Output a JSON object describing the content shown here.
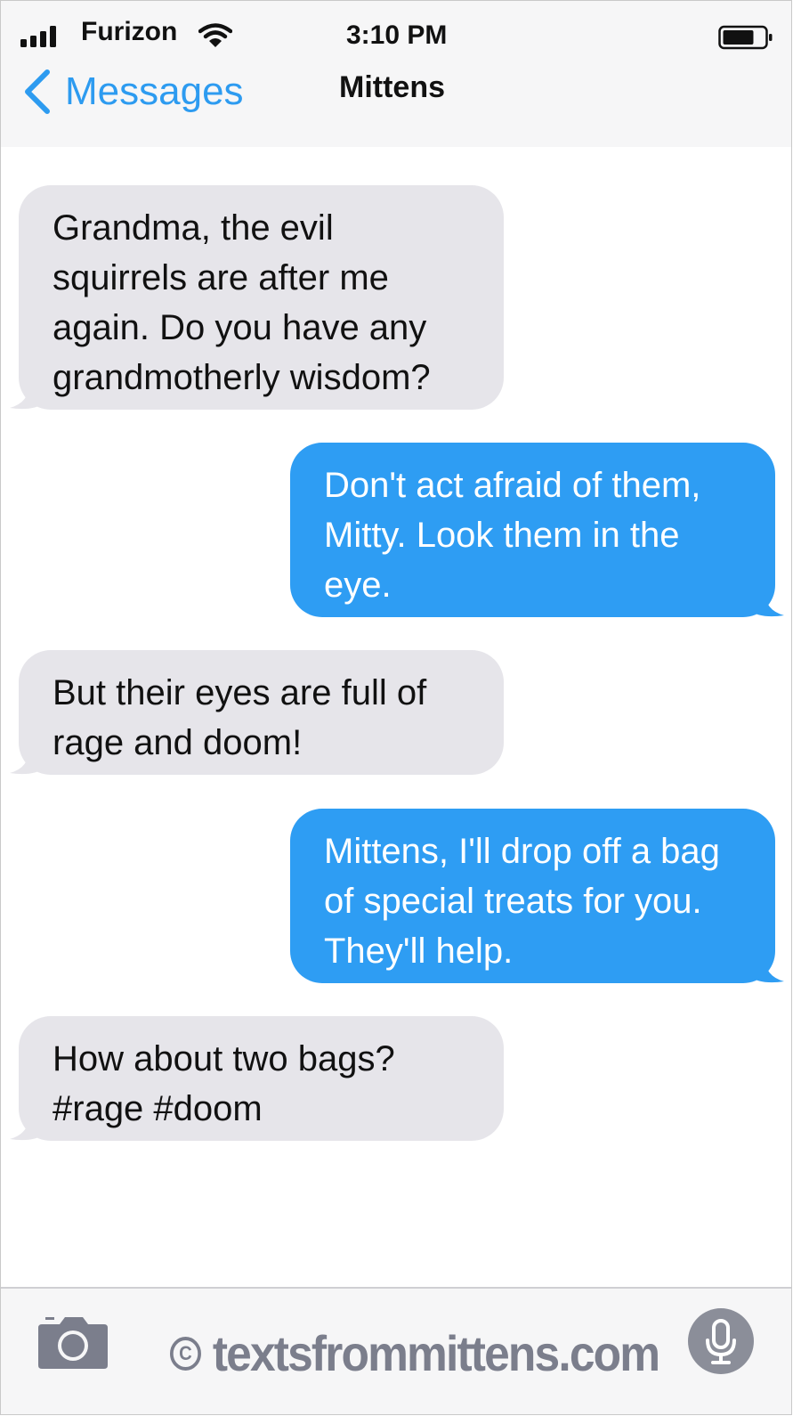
{
  "status_bar": {
    "carrier": "Furizon",
    "time": "3:10 PM",
    "signal_icon": "signal-bars-icon",
    "wifi_icon": "wifi-icon",
    "battery_icon": "battery-icon"
  },
  "nav": {
    "back_label": "Messages",
    "back_icon": "chevron-left-icon",
    "contact_name": "Mittens"
  },
  "messages": [
    {
      "direction": "received",
      "text": "Grandma, the evil squirrels are after me again. Do you have any grandmotherly wisdom?"
    },
    {
      "direction": "sent",
      "text": "Don't act afraid of them, Mitty. Look them in the eye."
    },
    {
      "direction": "received",
      "text": "But their eyes are full of rage and doom!"
    },
    {
      "direction": "sent",
      "text": "Mittens, I'll drop off a bag of special treats for you. They'll help."
    },
    {
      "direction": "received",
      "text": "How about two bags? #rage #doom"
    }
  ],
  "bottom_bar": {
    "camera_icon": "camera-icon",
    "copyright_symbol": "C",
    "watermark": "textsfrommittens.com",
    "mic_icon": "microphone-icon"
  },
  "colors": {
    "accent": "#2d9bf0",
    "sent_bubble": "#2e9df3",
    "received_bubble": "#e6e5ea",
    "bar_background": "#f6f6f7",
    "watermark": "#7b7e8c"
  }
}
